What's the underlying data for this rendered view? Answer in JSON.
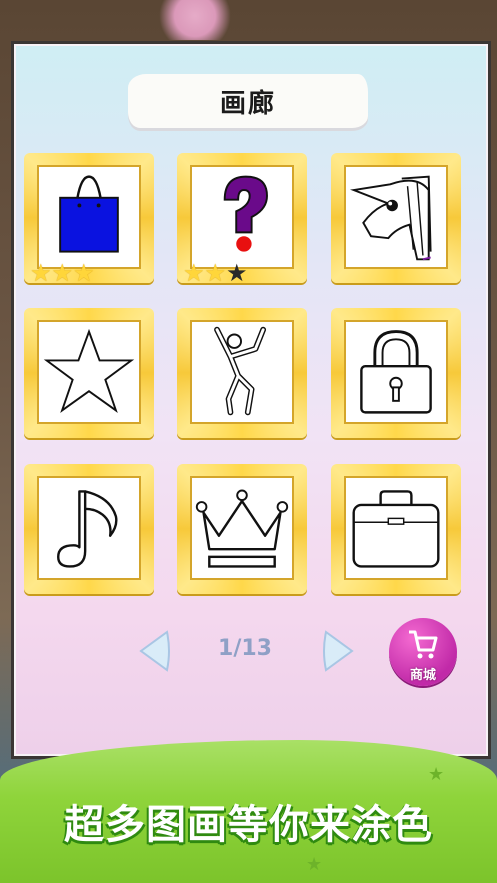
{
  "title": "画廊",
  "gallery": [
    {
      "name": "bag",
      "stars_filled": 3,
      "stars_total": 3
    },
    {
      "name": "question-mark",
      "stars_filled": 2,
      "stars_total": 3
    },
    {
      "name": "unicorn",
      "stars_filled": 0,
      "stars_total": 0
    },
    {
      "name": "star",
      "stars_filled": 0,
      "stars_total": 0
    },
    {
      "name": "dancer",
      "stars_filled": 0,
      "stars_total": 0
    },
    {
      "name": "lock",
      "stars_filled": 0,
      "stars_total": 0
    },
    {
      "name": "music-note",
      "stars_filled": 0,
      "stars_total": 0
    },
    {
      "name": "crown",
      "stars_filled": 0,
      "stars_total": 0
    },
    {
      "name": "briefcase",
      "stars_filled": 0,
      "stars_total": 0
    }
  ],
  "pager": {
    "label": "1/13"
  },
  "shop": {
    "label": "商城"
  },
  "banner": {
    "text": "超多图画等你来涂色"
  },
  "colors": {
    "bag_fill": "#0a12e0",
    "question_fill": "#6a0a8a",
    "dot": "#e81010",
    "shop": "#d33bb8",
    "banner": "#8fd43b"
  }
}
